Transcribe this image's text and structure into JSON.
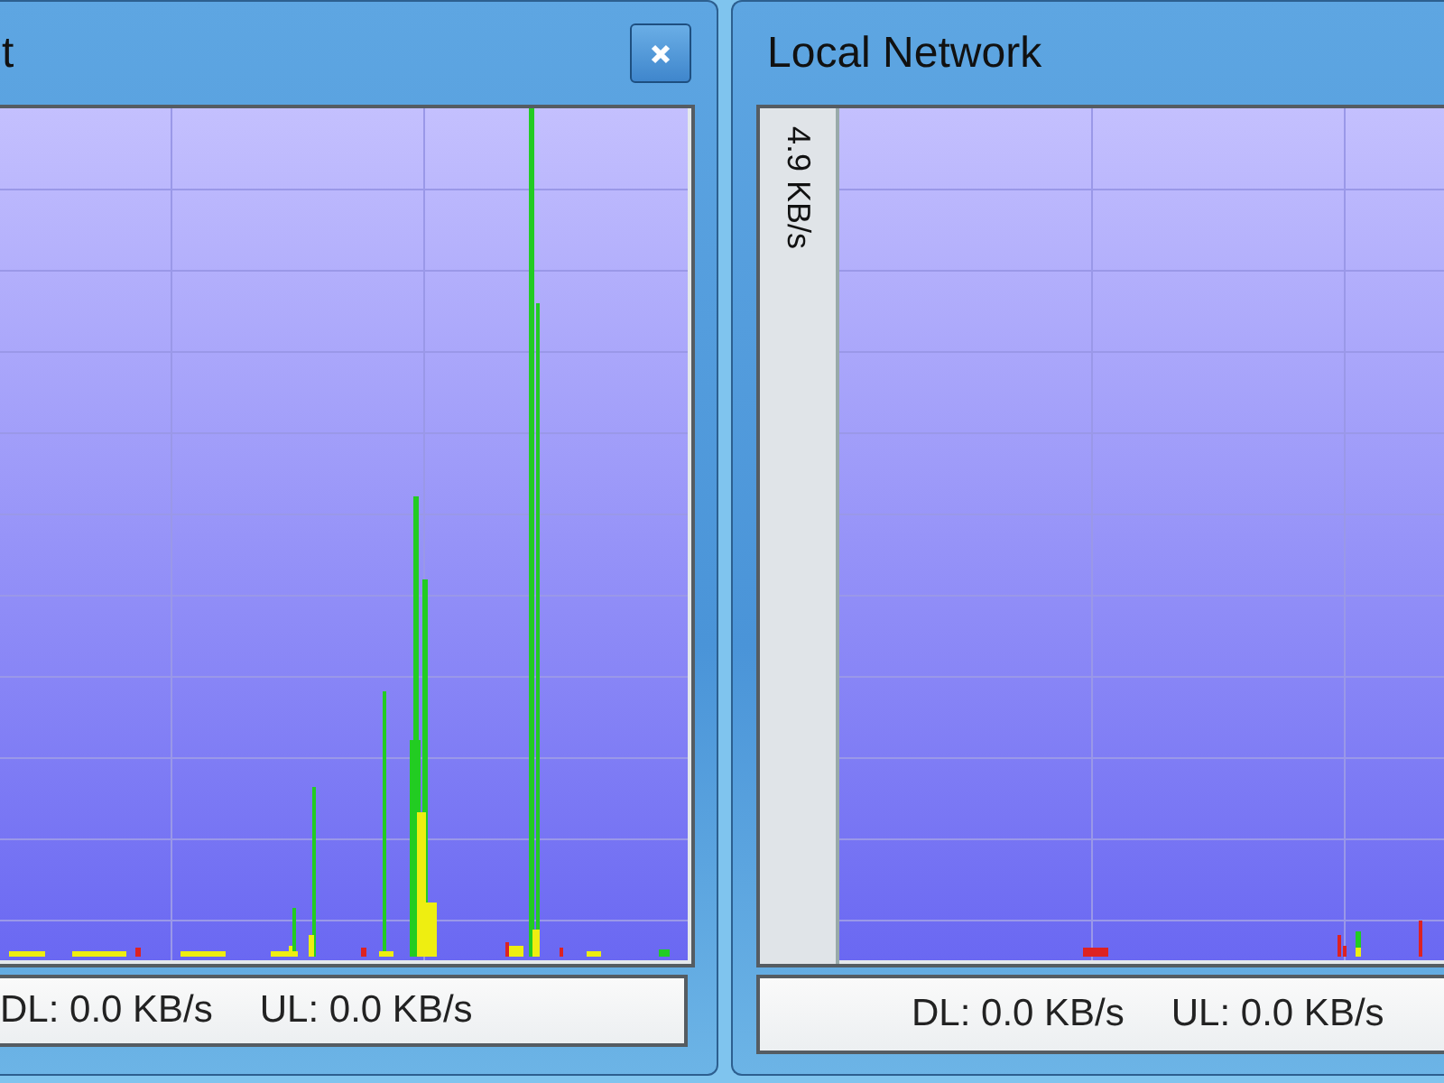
{
  "windows": [
    {
      "title": "t",
      "closable": true,
      "status": {
        "download": "DL: 0.0 KB/s",
        "upload": "UL: 0.0 KB/s"
      }
    },
    {
      "title": "Local Network",
      "closable": false,
      "axis_label": "4.9 KB/s",
      "status": {
        "download": "DL: 0.0 KB/s",
        "upload": "UL: 0.0 KB/s"
      }
    }
  ]
}
